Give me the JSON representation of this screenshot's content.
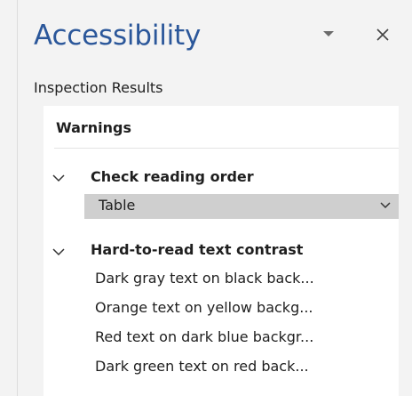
{
  "pane": {
    "title": "Accessibility",
    "subtitle": "Inspection Results",
    "icons": {
      "menu": "chevron-down-icon",
      "close": "close-icon"
    }
  },
  "results": {
    "category": "Warnings",
    "groups": [
      {
        "label": "Check reading order",
        "items": [
          "Table"
        ]
      },
      {
        "label": "Hard-to-read text contrast",
        "items": [
          "Dark gray text on black back...",
          "Orange text on yellow backg...",
          "Red text on dark blue backgr...",
          "Dark green text on red back..."
        ]
      }
    ]
  },
  "colors": {
    "title_blue": "#2b579a",
    "pane_bg": "#f3f3f3",
    "results_bg": "#ffffff",
    "selection_bg": "#cfcfcf"
  }
}
